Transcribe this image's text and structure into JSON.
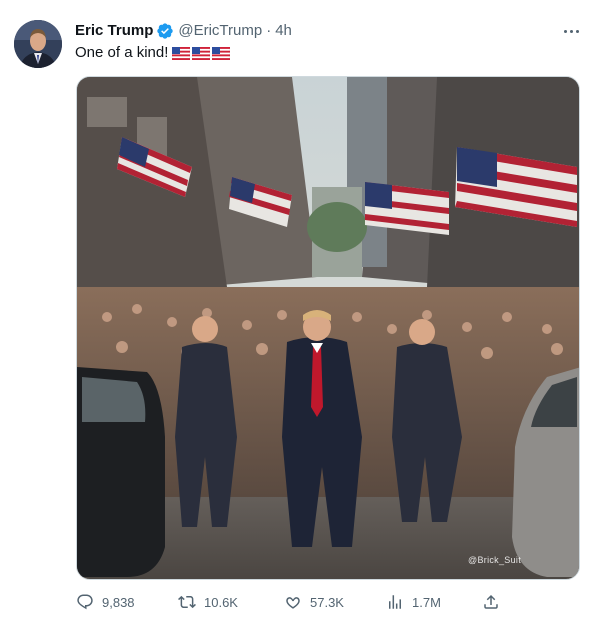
{
  "author": {
    "name": "Eric Trump",
    "handle": "@EricTrump",
    "separator": "·",
    "time": "4h",
    "verified": true,
    "avatar_icon": "profile-photo"
  },
  "tweet": {
    "text": "One of a kind!",
    "emoji_icons": [
      "us-flag-icon",
      "us-flag-icon",
      "us-flag-icon"
    ]
  },
  "media": {
    "watermark": "@Brick_Suit",
    "description_icon": "crowd-street-photo"
  },
  "actions": {
    "reply_count": "9,838",
    "retweet_count": "10.6K",
    "like_count": "57.3K",
    "view_count": "1.7M"
  },
  "colors": {
    "text_primary": "#0f1419",
    "text_secondary": "#536471",
    "verified_blue": "#1d9bf0",
    "border": "#cfd9de"
  }
}
